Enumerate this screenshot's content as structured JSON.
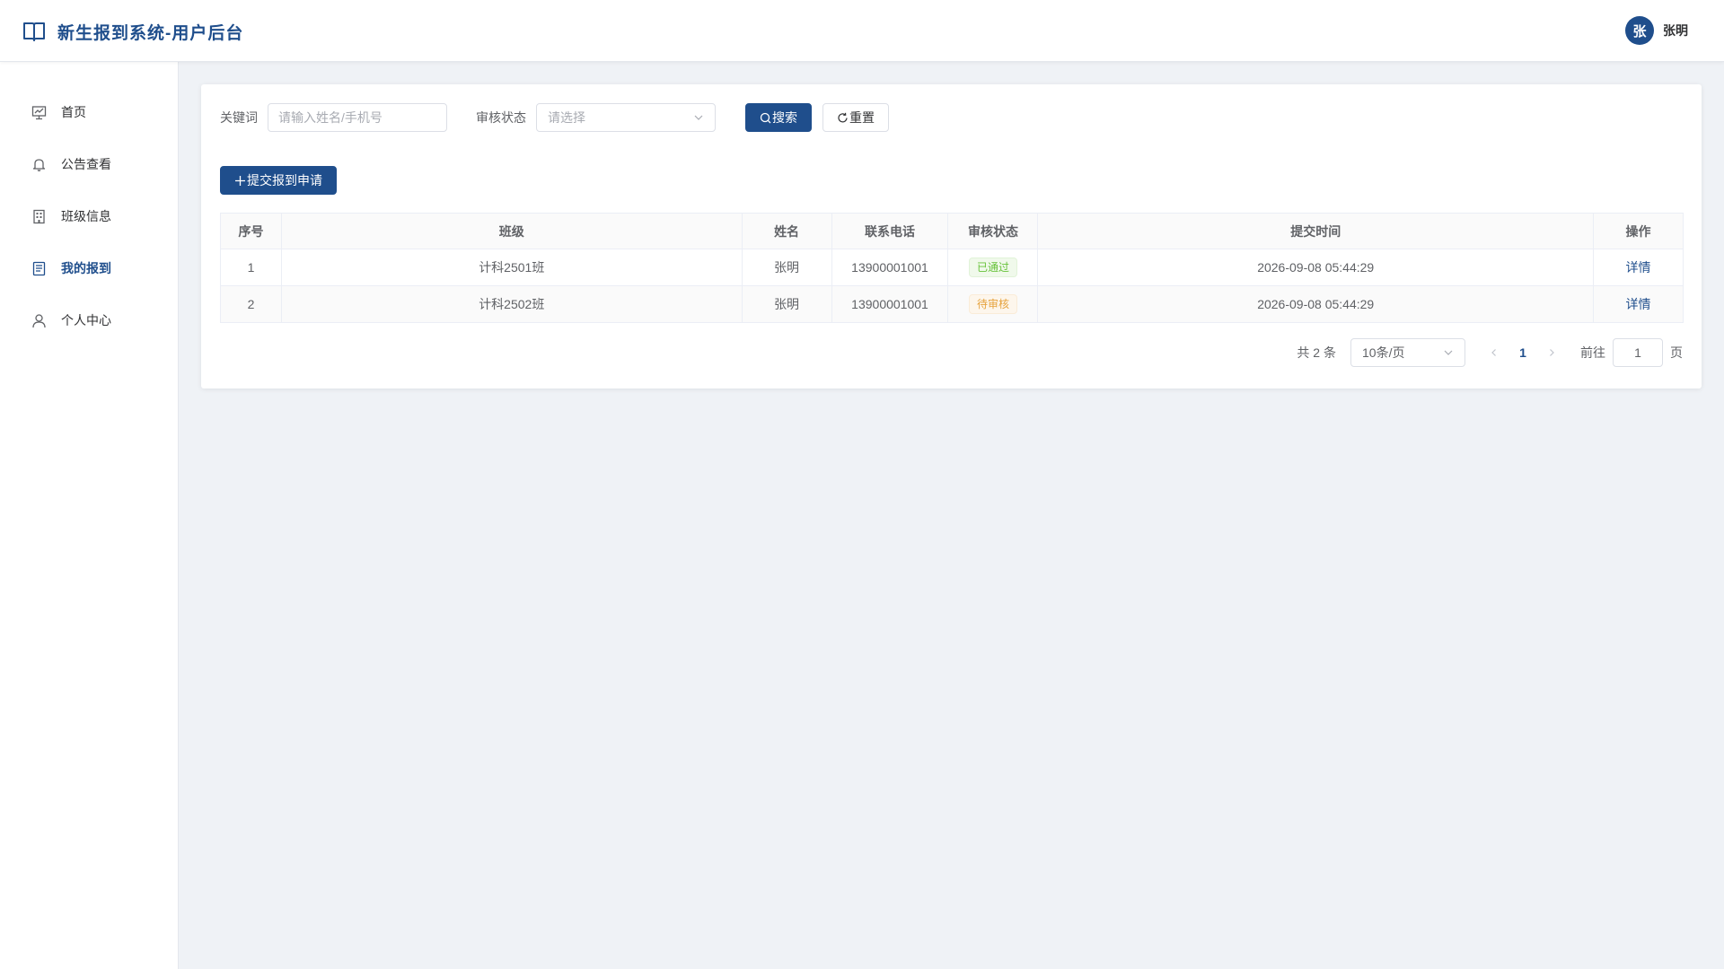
{
  "header": {
    "title": "新生报到系统-用户后台",
    "user": {
      "avatar_char": "张",
      "name": "张明"
    }
  },
  "sidebar": {
    "items": [
      {
        "label": "首页",
        "icon": "dashboard-icon",
        "active": false
      },
      {
        "label": "公告查看",
        "icon": "bell-icon",
        "active": false
      },
      {
        "label": "班级信息",
        "icon": "building-icon",
        "active": false
      },
      {
        "label": "我的报到",
        "icon": "document-icon",
        "active": true
      },
      {
        "label": "个人中心",
        "icon": "user-icon",
        "active": false
      }
    ]
  },
  "filters": {
    "keyword_label": "关键词",
    "keyword_placeholder": "请输入姓名/手机号",
    "status_label": "审核状态",
    "status_placeholder": "请选择",
    "search_label": "搜索",
    "reset_label": "重置"
  },
  "actions": {
    "add_label": "提交报到申请"
  },
  "table": {
    "columns": [
      "序号",
      "班级",
      "姓名",
      "联系电话",
      "审核状态",
      "提交时间",
      "操作"
    ],
    "rows": [
      {
        "index": "1",
        "class": "计科2501班",
        "name": "张明",
        "phone": "13900001001",
        "status": "已通过",
        "status_type": "success",
        "time": "2026-09-08 05:44:29",
        "action": "详情"
      },
      {
        "index": "2",
        "class": "计科2502班",
        "name": "张明",
        "phone": "13900001001",
        "status": "待审核",
        "status_type": "warning",
        "time": "2026-09-08 05:44:29",
        "action": "详情"
      }
    ]
  },
  "pagination": {
    "total_text": "共 2 条",
    "page_size": "10条/页",
    "current_page": "1",
    "goto_label": "前往",
    "goto_value": "1",
    "page_suffix": "页"
  },
  "colors": {
    "primary": "#1f4e8c",
    "success": "#67c23a",
    "warning": "#e6a23c",
    "background": "#eff2f6"
  }
}
